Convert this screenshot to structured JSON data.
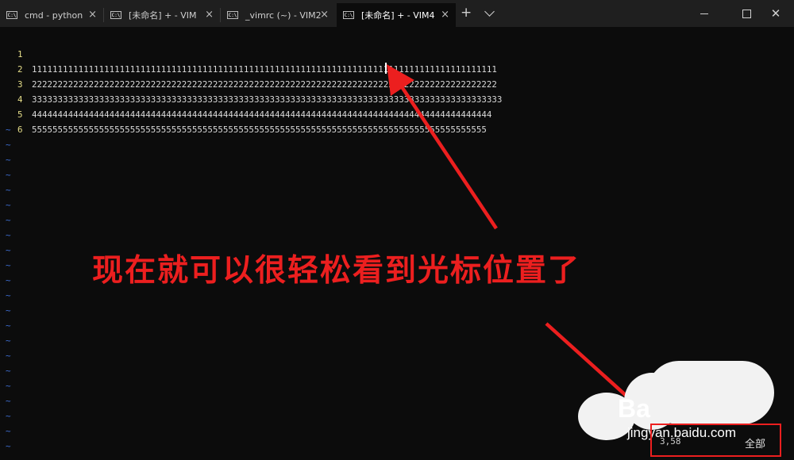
{
  "tabs": [
    {
      "label": "cmd - python",
      "icon": "terminal-icon"
    },
    {
      "label": "[未命名] + - VIM",
      "icon": "terminal-icon"
    },
    {
      "label": "_vimrc (~) - VIM2",
      "icon": "terminal-icon"
    },
    {
      "label": "[未命名] + - VIM4",
      "icon": "terminal-icon",
      "active": true
    }
  ],
  "tab_icon_text": "C:\\",
  "tab_close_glyph": "×",
  "new_tab_glyph": "+",
  "window_controls": {
    "close_glyph": "✕"
  },
  "editor": {
    "lines": [
      {
        "number": "1",
        "text": "111111111111111111111111111111111111111111111111111111111111111111111111111111111111111111"
      },
      {
        "number": "2",
        "text": "222222222222222222222222222222222222222222222222222222222222222222222222222222222222222222"
      },
      {
        "number": "3",
        "text": "3333333333333333333333333333333333333333333333333333333333333333333333333333333333333333333"
      },
      {
        "number": "4",
        "text": "44444444444444444444444444444444444444444444444444444444444444444444444444444444444444444"
      },
      {
        "number": "5",
        "text": "5555555555555555555555555555555555555555555555555555555555555555555555555555555555555555"
      },
      {
        "number": "6",
        "text": ""
      }
    ],
    "tilde_glyph": "~",
    "empty_line_count": 22
  },
  "annotation": {
    "text": "现在就可以很轻松看到光标位置了",
    "color": "#ec1f1f"
  },
  "watermark": {
    "text": "Ba",
    "subtext": "jingyan.baidu.com"
  },
  "status": {
    "cursor_position": "3,58",
    "scope": "全部"
  },
  "colors": {
    "background": "#0c0c0c",
    "line_number": "#e7df8a",
    "tilde": "#3e6fd6",
    "text": "#d9d9d9"
  }
}
